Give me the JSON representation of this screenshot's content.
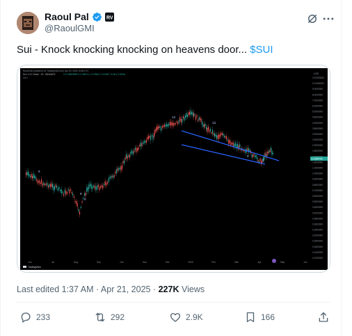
{
  "author": {
    "name": "Raoul Pal",
    "handle": "@RaoulGMI",
    "verified_icon": "verified-badge-icon",
    "affiliation_icon": "affiliation-badge-icon",
    "affiliation_label": "RV"
  },
  "tweet": {
    "text_prefix": "Sui - Knock knocking knocking on heavens door... ",
    "cashtag": "$SUI"
  },
  "chart_header": {
    "line1": "RaoulGMI published on TradingView.com, Apr 20, 2025 19:58 UTC",
    "line2": "Sui / U.S. Dollar · 1D · BINANCE",
    "ohlc": "O 2.25609599 H 2.45974 L 2.17980 C 2.31557 +0.06 (+2.63%)",
    "sub": "Vol 1"
  },
  "chart_data": {
    "type": "candlestick",
    "x_tick_labels": [
      "Jun",
      "Jul",
      "Aug",
      "Sep",
      "Oct",
      "Nov",
      "Dec",
      "2025",
      "Feb",
      "Mar",
      "Apr",
      "May",
      "Jun"
    ],
    "y_tick_labels": [
      "12.0000000",
      "11.0000000",
      "9.0000000",
      "8.0000000",
      "7.0000000",
      "6.0000000",
      "5.0000000",
      "4.5000000",
      "4.0000000",
      "3.5000000",
      "3.0000000",
      "2.5000000",
      "2.0000000",
      "1.8000000",
      "1.6000000",
      "1.4000000",
      "1.2000000",
      "1.0000000",
      "0.9000000",
      "0.8000000",
      "0.7000000",
      "0.6000000",
      "0.5000000",
      "0.4500000",
      "0.4000000",
      "0.3500000",
      "0.3000000",
      "0.2500000",
      "0.2000000",
      "0.1800000",
      "0.1600000",
      "0.1400000",
      "0.1200000"
    ],
    "y_axis_unit": "USD",
    "last_price_label": "2.3155700",
    "watermark": "TradingView",
    "count_labels": [
      "9",
      "9",
      "9",
      "13",
      "13",
      "9",
      "9"
    ]
  },
  "meta": {
    "edited": "Last edited 1:37 AM · Apr 21, 2025 · ",
    "views_count": "227K",
    "views_label": " Views"
  },
  "actions": {
    "replies": "233",
    "reposts": "292",
    "likes": "2.9K",
    "bookmarks": "166"
  }
}
